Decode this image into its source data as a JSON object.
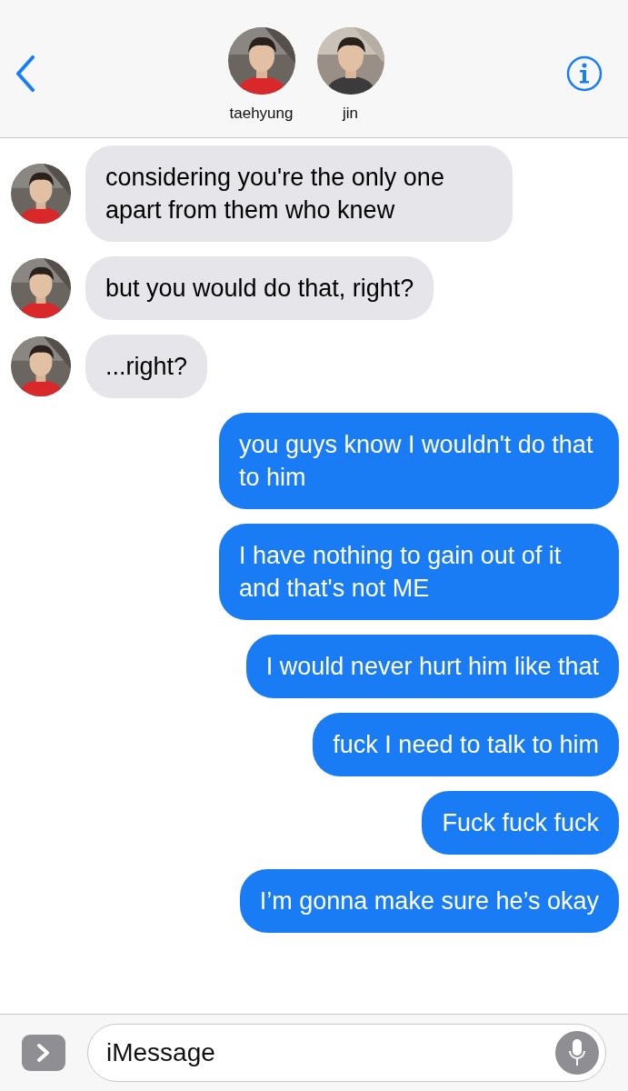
{
  "header": {
    "participants": [
      {
        "name": "taehyung",
        "kind": "picture"
      },
      {
        "name": "jin",
        "kind": "picture"
      }
    ]
  },
  "messages": [
    {
      "kind": "received",
      "text": "considering you're the only one apart from them who knew"
    },
    {
      "kind": "received",
      "text": "but you would do that, right?"
    },
    {
      "kind": "received",
      "text": "...right?"
    },
    {
      "kind": "sent",
      "text": "you guys know I wouldn't do that to him"
    },
    {
      "kind": "sent",
      "text": "I have nothing to gain out of it and that's not ME"
    },
    {
      "kind": "sent",
      "text": "I would never hurt him like that"
    },
    {
      "kind": "sent",
      "text": "fuck I need to talk to him"
    },
    {
      "kind": "sent",
      "text": "Fuck fuck fuck"
    },
    {
      "kind": "sent",
      "text": "I’m gonna make sure he’s okay"
    }
  ],
  "composer": {
    "placeholder": "iMessage"
  }
}
